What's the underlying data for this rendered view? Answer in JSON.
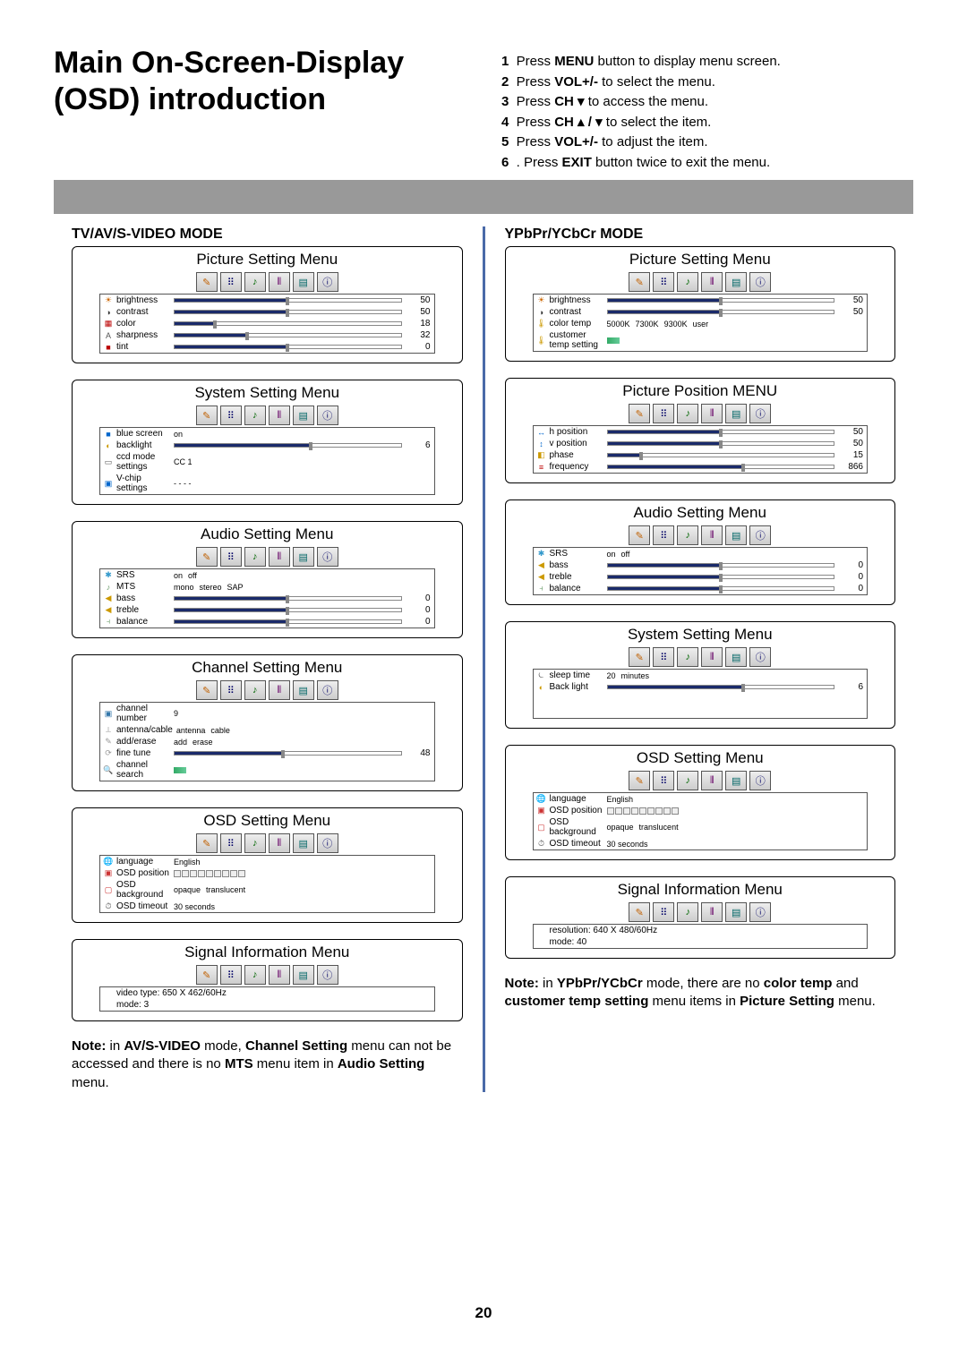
{
  "page_title": "Main On-Screen-Display (OSD) introduction",
  "page_number": "20",
  "instructions": [
    {
      "n": "1",
      "pre": "Press ",
      "bold": "MENU",
      "post": " button to display menu screen."
    },
    {
      "n": "2",
      "pre": "Press ",
      "bold": "VOL+/-",
      "post": " to select the menu."
    },
    {
      "n": "3",
      "pre": "Press ",
      "bold": "CH ▾",
      "post": " to access the menu."
    },
    {
      "n": "4",
      "pre": "Press ",
      "bold": "CH ▴ / ▾",
      "post": "   to select the item."
    },
    {
      "n": "5",
      "pre": "Press ",
      "bold": "VOL+/-",
      "post": " to adjust the item."
    },
    {
      "n": "6",
      "pre": ". Press ",
      "bold": "EXIT",
      "post": " button twice to exit the menu."
    }
  ],
  "left": {
    "mode_heading": "TV/AV/S-VIDEO MODE",
    "panels": [
      {
        "title": "Picture Setting Menu",
        "rows": [
          {
            "icon": "☀",
            "iconColor": "#c60",
            "label": "brightness",
            "type": "slider",
            "pct": 50,
            "val": "50"
          },
          {
            "icon": "◑",
            "iconColor": "#333",
            "label": "contrast",
            "type": "slider",
            "pct": 50,
            "val": "50"
          },
          {
            "icon": "▦",
            "iconColor": "#b00",
            "label": "color",
            "type": "slider",
            "pct": 18,
            "val": "18"
          },
          {
            "icon": "A",
            "iconColor": "#555",
            "label": "sharpness",
            "type": "slider",
            "pct": 32,
            "val": "32"
          },
          {
            "icon": "■",
            "iconColor": "#b00",
            "label": "tint",
            "type": "slider",
            "pct": 50,
            "val": "0"
          }
        ]
      },
      {
        "title": "System Setting Menu",
        "rows": [
          {
            "icon": "■",
            "iconColor": "#06c",
            "label": "blue screen",
            "type": "opts",
            "opts": [
              "on"
            ]
          },
          {
            "icon": "◐",
            "iconColor": "#c90",
            "label": "backlight",
            "type": "slider",
            "pct": 60,
            "val": "6"
          },
          {
            "icon": "▭",
            "iconColor": "#555",
            "label": "ccd mode settings",
            "type": "opts",
            "opts": [
              "CC 1"
            ]
          },
          {
            "icon": "▣",
            "iconColor": "#06c",
            "label": "V-chip settings",
            "type": "opts",
            "opts": [
              "- - - -"
            ]
          }
        ]
      },
      {
        "title": "Audio Setting Menu",
        "rows": [
          {
            "icon": "✱",
            "iconColor": "#39c",
            "label": "SRS",
            "type": "opts",
            "opts": [
              "on",
              "off"
            ]
          },
          {
            "icon": "♪",
            "iconColor": "#696",
            "label": "MTS",
            "type": "opts",
            "opts": [
              "mono",
              "stereo",
              "SAP"
            ]
          },
          {
            "icon": "◀",
            "iconColor": "#c90",
            "label": "bass",
            "type": "slider",
            "pct": 50,
            "val": "0"
          },
          {
            "icon": "◀",
            "iconColor": "#c90",
            "label": "treble",
            "type": "slider",
            "pct": 50,
            "val": "0"
          },
          {
            "icon": "⫞",
            "iconColor": "#696",
            "label": "balance",
            "type": "slider",
            "pct": 50,
            "val": "0"
          }
        ]
      },
      {
        "title": "Channel Setting Menu",
        "rows": [
          {
            "icon": "▣",
            "iconColor": "#37a",
            "label": "channel number",
            "type": "opts",
            "opts": [
              "9"
            ]
          },
          {
            "icon": "⟂",
            "iconColor": "#999",
            "label": "antenna/cable",
            "type": "opts",
            "opts": [
              "antenna",
              "cable"
            ]
          },
          {
            "icon": "✎",
            "iconColor": "#999",
            "label": "add/erase",
            "type": "opts",
            "opts": [
              "add",
              "erase"
            ]
          },
          {
            "icon": "⟳",
            "iconColor": "#999",
            "label": "fine tune",
            "type": "slider",
            "pct": 48,
            "val": "48"
          },
          {
            "icon": "🔍",
            "iconColor": "#999",
            "label": "channel search",
            "type": "arrow"
          }
        ]
      },
      {
        "title": "OSD Setting Menu",
        "rows": [
          {
            "icon": "🌐",
            "iconColor": "#c60",
            "label": "language",
            "type": "opts",
            "opts": [
              "English"
            ]
          },
          {
            "icon": "▣",
            "iconColor": "#c33",
            "label": "OSD position",
            "type": "posboxes"
          },
          {
            "icon": "▢",
            "iconColor": "#c33",
            "label": "OSD background",
            "type": "opts",
            "opts": [
              "opaque",
              "translucent"
            ]
          },
          {
            "icon": "⏱",
            "iconColor": "#555",
            "label": "OSD timeout",
            "type": "opts",
            "opts": [
              "30 seconds"
            ]
          }
        ]
      },
      {
        "title": "Signal Information Menu",
        "rows": [
          {
            "icon": "",
            "label": "video type: 650 X 462/60Hz",
            "type": "plain"
          },
          {
            "icon": "",
            "label": "mode:       3",
            "type": "plain"
          }
        ]
      }
    ],
    "note_html": "<b>Note:</b> in <b>AV/S-VIDEO</b> mode, <b>Channel Setting</b> menu can not be accessed and there is no <b>MTS</b> menu item in <b>Audio Setting</b> menu."
  },
  "right": {
    "mode_heading": "YPbPr/YCbCr MODE",
    "panels": [
      {
        "title": "Picture Setting Menu",
        "rows": [
          {
            "icon": "☀",
            "iconColor": "#c60",
            "label": "brightness",
            "type": "slider",
            "pct": 50,
            "val": "50"
          },
          {
            "icon": "◑",
            "iconColor": "#333",
            "label": "contrast",
            "type": "slider",
            "pct": 50,
            "val": "50"
          },
          {
            "icon": "🌡",
            "iconColor": "#c90",
            "label": "color temp",
            "type": "opts",
            "opts": [
              "5000K",
              "7300K",
              "9300K",
              "user"
            ]
          },
          {
            "icon": "🌡",
            "iconColor": "#c90",
            "label": "customer temp setting",
            "type": "arrow"
          }
        ]
      },
      {
        "title": "Picture Position MENU",
        "rows": [
          {
            "icon": "↔",
            "iconColor": "#06c",
            "label": "h position",
            "type": "slider",
            "pct": 50,
            "val": "50"
          },
          {
            "icon": "↕",
            "iconColor": "#06c",
            "label": "v position",
            "type": "slider",
            "pct": 50,
            "val": "50"
          },
          {
            "icon": "◧",
            "iconColor": "#c90",
            "label": "phase",
            "type": "slider",
            "pct": 15,
            "val": "15"
          },
          {
            "icon": "≡",
            "iconColor": "#b00",
            "label": "frequency",
            "type": "slider",
            "pct": 60,
            "val": "866"
          }
        ]
      },
      {
        "title": "Audio Setting Menu",
        "rows": [
          {
            "icon": "✱",
            "iconColor": "#39c",
            "label": "SRS",
            "type": "opts",
            "opts": [
              "on",
              "off"
            ]
          },
          {
            "icon": "◀",
            "iconColor": "#c90",
            "label": "bass",
            "type": "slider",
            "pct": 50,
            "val": "0"
          },
          {
            "icon": "◀",
            "iconColor": "#c90",
            "label": "treble",
            "type": "slider",
            "pct": 50,
            "val": "0"
          },
          {
            "icon": "⫞",
            "iconColor": "#696",
            "label": "balance",
            "type": "slider",
            "pct": 50,
            "val": "0"
          }
        ]
      },
      {
        "title": "System Setting Menu",
        "rows": [
          {
            "icon": "⏾",
            "iconColor": "#555",
            "label": "sleep time",
            "type": "opts",
            "opts": [
              "20",
              "minutes"
            ]
          },
          {
            "icon": "◐",
            "iconColor": "#c90",
            "label": "Back light",
            "type": "slider",
            "pct": 60,
            "val": "6"
          }
        ],
        "pad_bottom": 28
      },
      {
        "title": "OSD Setting Menu",
        "rows": [
          {
            "icon": "🌐",
            "iconColor": "#c60",
            "label": "language",
            "type": "opts",
            "opts": [
              "English"
            ]
          },
          {
            "icon": "▣",
            "iconColor": "#c33",
            "label": "OSD position",
            "type": "posboxes"
          },
          {
            "icon": "▢",
            "iconColor": "#c33",
            "label": "OSD background",
            "type": "opts",
            "opts": [
              "opaque",
              "translucent"
            ]
          },
          {
            "icon": "⏱",
            "iconColor": "#555",
            "label": "OSD timeout",
            "type": "opts",
            "opts": [
              "30 seconds"
            ]
          }
        ]
      },
      {
        "title": "Signal Information Menu",
        "rows": [
          {
            "icon": "",
            "label": "resolution: 640 X 480/60Hz",
            "type": "plain"
          },
          {
            "icon": "",
            "label": "mode:     40",
            "type": "plain"
          }
        ]
      }
    ],
    "note_html": "<b>Note:</b> in <b>YPbPr/YCbCr</b> mode, there are no <b>color temp</b> and <b>customer temp setting</b> menu items in <b>Picture Setting</b> menu."
  },
  "icon_glyphs": [
    "✎",
    "⠿",
    "♪",
    "⦀",
    "▤",
    "ⓘ"
  ]
}
